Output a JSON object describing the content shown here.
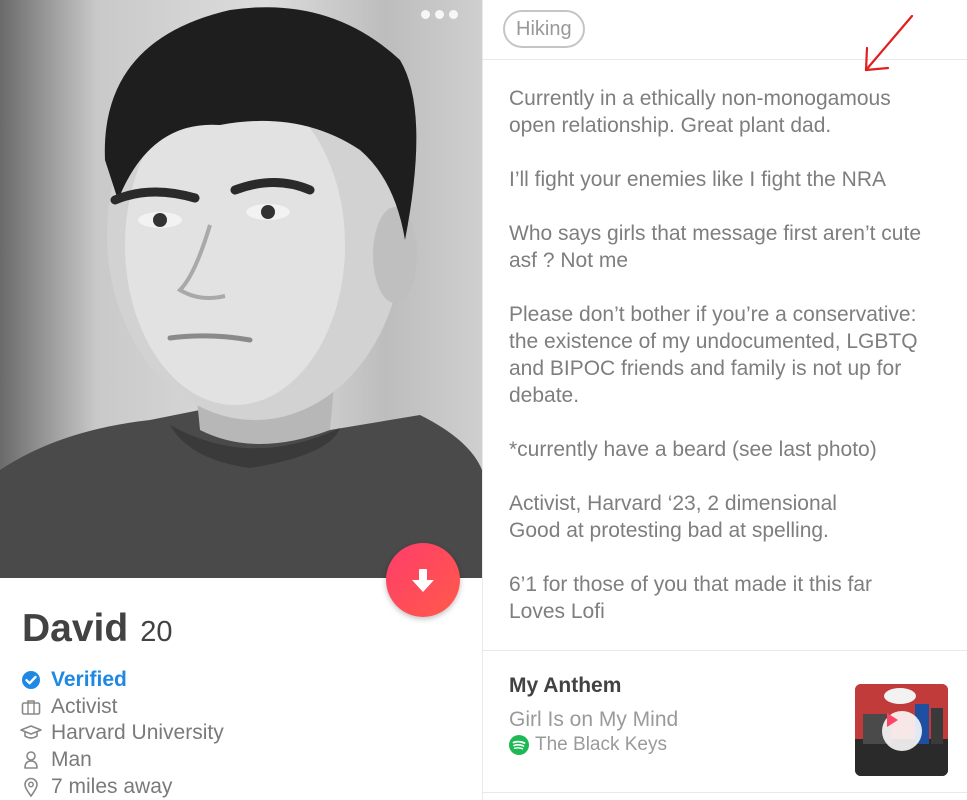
{
  "profile": {
    "name": "David",
    "age": "20",
    "photo_alt": "profile-photo"
  },
  "info": [
    {
      "icon": "verified-badge-icon",
      "text": "Verified"
    },
    {
      "icon": "briefcase-icon",
      "text": "Activist"
    },
    {
      "icon": "graduation-cap-icon",
      "text": "Harvard University"
    },
    {
      "icon": "person-icon",
      "text": "Man"
    },
    {
      "icon": "location-pin-icon",
      "text": "7 miles away"
    }
  ],
  "interests": [
    "Hiking"
  ],
  "bio": [
    "Currently in a ethically non-monogamous\nopen relationship. Great plant dad.",
    "I’ll fight your enemies like I fight the NRA",
    "Who says girls that message first aren’t cute\nasf ?  Not me",
    "Please don’t bother if you’re a conservative:\nthe existence of my undocumented, LGBTQ\nand BIPOC friends and family is not up for\ndebate.",
    "*currently have a beard (see last photo)",
    "Activist, Harvard ‘23, 2 dimensional\nGood at protesting bad at spelling.",
    "6’1 for those of you that made it this far\nLoves Lofi"
  ],
  "anthem": {
    "heading": "My Anthem",
    "song": "Girl Is on My Mind",
    "artist": "The Black Keys",
    "service_icon": "spotify-icon"
  },
  "colors": {
    "accent_pink": "#ff4466",
    "verified_blue": "#1e88e5",
    "annotation_red": "#e02020"
  }
}
